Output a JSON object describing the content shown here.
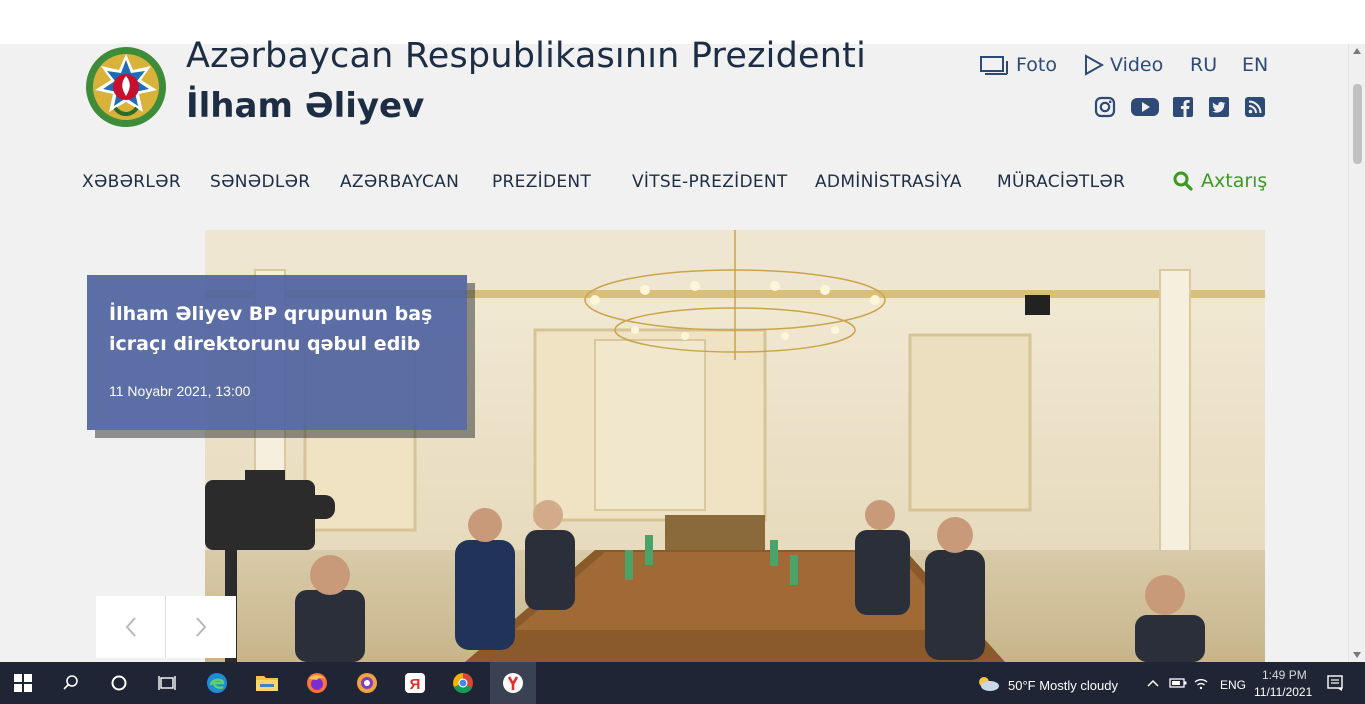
{
  "header": {
    "title_line1": "Azərbaycan Respublikasının Prezidenti",
    "title_line2": "İlham Əliyev"
  },
  "toplinks": {
    "foto": "Foto",
    "video": "Video",
    "ru": "RU",
    "en": "EN"
  },
  "social": [
    "instagram-icon",
    "youtube-icon",
    "facebook-icon",
    "twitter-icon",
    "rss-icon"
  ],
  "nav": {
    "items": [
      "XƏBƏRLƏR",
      "SƏNƏDLƏR",
      "AZƏRBAYCAN",
      "PREZİDENT",
      "VİTSE-PREZİDENT",
      "ADMİNİSTRASİYA",
      "MÜRACİƏTLƏR"
    ],
    "search_label": "Axtarış"
  },
  "hero": {
    "title": "İlham Əliyev BP qrupunun baş icraçı direktorunu qəbul edib",
    "date": "11 Noyabr 2021, 13:00"
  },
  "taskbar": {
    "weather": "50°F  Mostly cloudy",
    "lang": "ENG",
    "time": "1:49 PM",
    "date": "11/11/2021"
  },
  "colors": {
    "title": "#1d2d44",
    "link": "#2e4a78",
    "search": "#3c9a1e",
    "card": "#4e63a0"
  }
}
